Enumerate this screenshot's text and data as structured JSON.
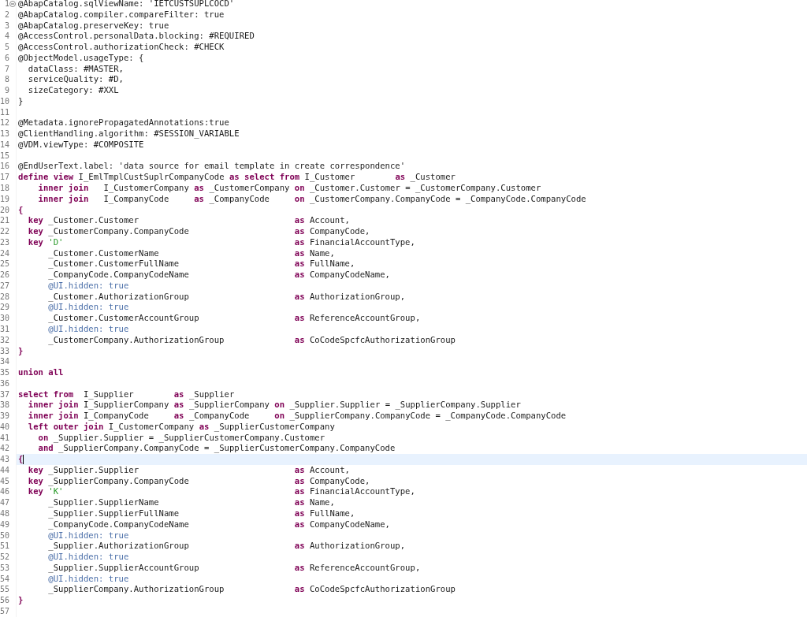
{
  "editor": {
    "lines": [
      {
        "number": "1",
        "current": false,
        "fold": true,
        "tokens": [
          {
            "kind": "plain",
            "text": "@AbapCatalog.sqlViewName: 'IETCUSTSUPLCOCD'"
          }
        ]
      },
      {
        "number": "2",
        "current": false,
        "fold": false,
        "tokens": [
          {
            "kind": "plain",
            "text": "@AbapCatalog.compiler.compareFilter: true"
          }
        ]
      },
      {
        "number": "3",
        "current": false,
        "fold": false,
        "tokens": [
          {
            "kind": "plain",
            "text": "@AbapCatalog.preserveKey: true"
          }
        ]
      },
      {
        "number": "4",
        "current": false,
        "fold": false,
        "tokens": [
          {
            "kind": "plain",
            "text": "@AccessControl.personalData.blocking: #REQUIRED"
          }
        ]
      },
      {
        "number": "5",
        "current": false,
        "fold": false,
        "tokens": [
          {
            "kind": "plain",
            "text": "@AccessControl.authorizationCheck: #CHECK"
          }
        ]
      },
      {
        "number": "6",
        "current": false,
        "fold": false,
        "tokens": [
          {
            "kind": "plain",
            "text": "@ObjectModel.usageType: {"
          }
        ]
      },
      {
        "number": "7",
        "current": false,
        "fold": false,
        "tokens": [
          {
            "kind": "plain",
            "text": "  dataClass: #MASTER,"
          }
        ]
      },
      {
        "number": "8",
        "current": false,
        "fold": false,
        "tokens": [
          {
            "kind": "plain",
            "text": "  serviceQuality: #D,"
          }
        ]
      },
      {
        "number": "9",
        "current": false,
        "fold": false,
        "tokens": [
          {
            "kind": "plain",
            "text": "  sizeCategory: #XXL"
          }
        ]
      },
      {
        "number": "10",
        "current": false,
        "fold": false,
        "tokens": [
          {
            "kind": "plain",
            "text": "}"
          }
        ]
      },
      {
        "number": "11",
        "current": false,
        "fold": false
      },
      {
        "number": "12",
        "current": false,
        "fold": false,
        "tokens": [
          {
            "kind": "plain",
            "text": "@Metadata.ignorePropagatedAnnotations:true"
          }
        ]
      },
      {
        "number": "13",
        "current": false,
        "fold": false,
        "tokens": [
          {
            "kind": "plain",
            "text": "@ClientHandling.algorithm: #SESSION_VARIABLE"
          }
        ]
      },
      {
        "number": "14",
        "current": false,
        "fold": false,
        "tokens": [
          {
            "kind": "plain",
            "text": "@VDM.viewType: #COMPOSITE"
          }
        ]
      },
      {
        "number": "15",
        "current": false,
        "fold": false
      },
      {
        "number": "16",
        "current": false,
        "fold": false,
        "tokens": [
          {
            "kind": "plain",
            "text": "@EndUserText.label: 'data source for email template in create correspondence'"
          }
        ]
      },
      {
        "number": "17",
        "current": false,
        "fold": false,
        "tokens": [
          {
            "kind": "keyword",
            "text": "define view"
          },
          {
            "kind": "plain",
            "text": " I_EmlTmplCustSuplrCompanyCode "
          },
          {
            "kind": "keyword",
            "text": "as select from"
          },
          {
            "kind": "plain",
            "text": " I_Customer        "
          },
          {
            "kind": "keyword",
            "text": "as"
          },
          {
            "kind": "plain",
            "text": " _Customer"
          }
        ]
      },
      {
        "number": "18",
        "current": false,
        "fold": false,
        "tokens": [
          {
            "kind": "keyword",
            "text": "    inner join"
          },
          {
            "kind": "plain",
            "text": "   I_CustomerCompany "
          },
          {
            "kind": "keyword",
            "text": "as"
          },
          {
            "kind": "plain",
            "text": " _CustomerCompany "
          },
          {
            "kind": "keyword",
            "text": "on"
          },
          {
            "kind": "plain",
            "text": " _Customer.Customer = _CustomerCompany.Customer"
          }
        ]
      },
      {
        "number": "19",
        "current": false,
        "fold": false,
        "tokens": [
          {
            "kind": "keyword",
            "text": "    inner join"
          },
          {
            "kind": "plain",
            "text": "   I_CompanyCode     "
          },
          {
            "kind": "keyword",
            "text": "as"
          },
          {
            "kind": "plain",
            "text": " _CompanyCode     "
          },
          {
            "kind": "keyword",
            "text": "on"
          },
          {
            "kind": "plain",
            "text": " _CustomerCompany.CompanyCode = _CompanyCode.CompanyCode"
          }
        ]
      },
      {
        "number": "20",
        "current": false,
        "fold": false,
        "tokens": [
          {
            "kind": "keyword",
            "text": "{"
          }
        ]
      },
      {
        "number": "21",
        "current": false,
        "fold": false,
        "tokens": [
          {
            "kind": "keyword",
            "text": "  key"
          },
          {
            "kind": "plain",
            "text": " _Customer.Customer                               "
          },
          {
            "kind": "keyword",
            "text": "as"
          },
          {
            "kind": "plain",
            "text": " Account,"
          }
        ]
      },
      {
        "number": "22",
        "current": false,
        "fold": false,
        "tokens": [
          {
            "kind": "keyword",
            "text": "  key"
          },
          {
            "kind": "plain",
            "text": " _CustomerCompany.CompanyCode                     "
          },
          {
            "kind": "keyword",
            "text": "as"
          },
          {
            "kind": "plain",
            "text": " CompanyCode,"
          }
        ]
      },
      {
        "number": "23",
        "current": false,
        "fold": false,
        "tokens": [
          {
            "kind": "keyword",
            "text": "  key"
          },
          {
            "kind": "literal",
            "text": " 'D'"
          },
          {
            "kind": "keyword",
            "text": "                                              as"
          },
          {
            "kind": "plain",
            "text": " FinancialAccountType,"
          }
        ]
      },
      {
        "number": "24",
        "current": false,
        "fold": false,
        "tokens": [
          {
            "kind": "plain",
            "text": "      _Customer.CustomerName                           "
          },
          {
            "kind": "keyword",
            "text": "as"
          },
          {
            "kind": "plain",
            "text": " Name,"
          }
        ]
      },
      {
        "number": "25",
        "current": false,
        "fold": false,
        "tokens": [
          {
            "kind": "plain",
            "text": "      _Customer.CustomerFullName                       "
          },
          {
            "kind": "keyword",
            "text": "as"
          },
          {
            "kind": "plain",
            "text": " FullName,"
          }
        ]
      },
      {
        "number": "26",
        "current": false,
        "fold": false,
        "tokens": [
          {
            "kind": "plain",
            "text": "      _CompanyCode.CompanyCodeName                     "
          },
          {
            "kind": "keyword",
            "text": "as"
          },
          {
            "kind": "plain",
            "text": " CompanyCodeName,"
          }
        ]
      },
      {
        "number": "27",
        "current": false,
        "fold": false,
        "tokens": [
          {
            "kind": "annotation",
            "text": "      @UI.hidden: true"
          }
        ]
      },
      {
        "number": "28",
        "current": false,
        "fold": false,
        "tokens": [
          {
            "kind": "plain",
            "text": "      _Customer.AuthorizationGroup                     "
          },
          {
            "kind": "keyword",
            "text": "as"
          },
          {
            "kind": "plain",
            "text": " AuthorizationGroup,"
          }
        ]
      },
      {
        "number": "29",
        "current": false,
        "fold": false,
        "tokens": [
          {
            "kind": "annotation",
            "text": "      @UI.hidden: true"
          }
        ]
      },
      {
        "number": "30",
        "current": false,
        "fold": false,
        "tokens": [
          {
            "kind": "plain",
            "text": "      _Customer.CustomerAccountGroup                   "
          },
          {
            "kind": "keyword",
            "text": "as"
          },
          {
            "kind": "plain",
            "text": " ReferenceAccountGroup,"
          }
        ]
      },
      {
        "number": "31",
        "current": false,
        "fold": false,
        "tokens": [
          {
            "kind": "annotation",
            "text": "      @UI.hidden: true"
          }
        ]
      },
      {
        "number": "32",
        "current": false,
        "fold": false,
        "tokens": [
          {
            "kind": "plain",
            "text": "      _CustomerCompany.AuthorizationGroup              "
          },
          {
            "kind": "keyword",
            "text": "as"
          },
          {
            "kind": "plain",
            "text": " CoCodeSpcfcAuthorizationGroup"
          }
        ]
      },
      {
        "number": "33",
        "current": false,
        "fold": false,
        "tokens": [
          {
            "kind": "keyword",
            "text": "}"
          }
        ]
      },
      {
        "number": "34",
        "current": false,
        "fold": false
      },
      {
        "number": "35",
        "current": false,
        "fold": false,
        "tokens": [
          {
            "kind": "keyword",
            "text": "union all"
          }
        ]
      },
      {
        "number": "36",
        "current": false,
        "fold": false
      },
      {
        "number": "37",
        "current": false,
        "fold": false,
        "tokens": [
          {
            "kind": "keyword",
            "text": "select from"
          },
          {
            "kind": "plain",
            "text": "  I_Supplier        "
          },
          {
            "kind": "keyword",
            "text": "as"
          },
          {
            "kind": "plain",
            "text": " _Supplier"
          }
        ]
      },
      {
        "number": "38",
        "current": false,
        "fold": false,
        "tokens": [
          {
            "kind": "keyword",
            "text": "  inner join"
          },
          {
            "kind": "plain",
            "text": " I_SupplierCompany "
          },
          {
            "kind": "keyword",
            "text": "as"
          },
          {
            "kind": "plain",
            "text": " _SupplierCompany "
          },
          {
            "kind": "keyword",
            "text": "on"
          },
          {
            "kind": "plain",
            "text": " _Supplier.Supplier = _SupplierCompany.Supplier"
          }
        ]
      },
      {
        "number": "39",
        "current": false,
        "fold": false,
        "tokens": [
          {
            "kind": "keyword",
            "text": "  inner join"
          },
          {
            "kind": "plain",
            "text": " I_CompanyCode     "
          },
          {
            "kind": "keyword",
            "text": "as"
          },
          {
            "kind": "plain",
            "text": " _CompanyCode     "
          },
          {
            "kind": "keyword",
            "text": "on"
          },
          {
            "kind": "plain",
            "text": " _SupplierCompany.CompanyCode = _CompanyCode.CompanyCode"
          }
        ]
      },
      {
        "number": "40",
        "current": false,
        "fold": false,
        "tokens": [
          {
            "kind": "keyword",
            "text": "  left outer join"
          },
          {
            "kind": "plain",
            "text": " I_CustomerCompany "
          },
          {
            "kind": "keyword",
            "text": "as"
          },
          {
            "kind": "plain",
            "text": " _SupplierCustomerCompany"
          }
        ]
      },
      {
        "number": "41",
        "current": false,
        "fold": false,
        "tokens": [
          {
            "kind": "keyword",
            "text": "    on"
          },
          {
            "kind": "plain",
            "text": " _Supplier.Supplier = _SupplierCustomerCompany.Customer"
          }
        ]
      },
      {
        "number": "42",
        "current": false,
        "fold": false,
        "tokens": [
          {
            "kind": "keyword",
            "text": "    and"
          },
          {
            "kind": "plain",
            "text": " _SupplierCompany.CompanyCode = _SupplierCustomerCompany.CompanyCode"
          }
        ]
      },
      {
        "number": "43",
        "current": true,
        "fold": false,
        "tokens": [
          {
            "kind": "keyword",
            "text": "{"
          }
        ]
      },
      {
        "number": "44",
        "current": false,
        "fold": false,
        "tokens": [
          {
            "kind": "keyword",
            "text": "  key"
          },
          {
            "kind": "plain",
            "text": " _Supplier.Supplier                               "
          },
          {
            "kind": "keyword",
            "text": "as"
          },
          {
            "kind": "plain",
            "text": " Account,"
          }
        ]
      },
      {
        "number": "45",
        "current": false,
        "fold": false,
        "tokens": [
          {
            "kind": "keyword",
            "text": "  key"
          },
          {
            "kind": "plain",
            "text": " _SupplierCompany.CompanyCode                     "
          },
          {
            "kind": "keyword",
            "text": "as"
          },
          {
            "kind": "plain",
            "text": " CompanyCode,"
          }
        ]
      },
      {
        "number": "46",
        "current": false,
        "fold": false,
        "tokens": [
          {
            "kind": "keyword",
            "text": "  key"
          },
          {
            "kind": "literal",
            "text": " 'K'"
          },
          {
            "kind": "keyword",
            "text": "                                              as"
          },
          {
            "kind": "plain",
            "text": " FinancialAccountType,"
          }
        ]
      },
      {
        "number": "47",
        "current": false,
        "fold": false,
        "tokens": [
          {
            "kind": "plain",
            "text": "      _Supplier.SupplierName                           "
          },
          {
            "kind": "keyword",
            "text": "as"
          },
          {
            "kind": "plain",
            "text": " Name,"
          }
        ]
      },
      {
        "number": "48",
        "current": false,
        "fold": false,
        "tokens": [
          {
            "kind": "plain",
            "text": "      _Supplier.SupplierFullName                       "
          },
          {
            "kind": "keyword",
            "text": "as"
          },
          {
            "kind": "plain",
            "text": " FullName,"
          }
        ]
      },
      {
        "number": "49",
        "current": false,
        "fold": false,
        "tokens": [
          {
            "kind": "plain",
            "text": "      _CompanyCode.CompanyCodeName                     "
          },
          {
            "kind": "keyword",
            "text": "as"
          },
          {
            "kind": "plain",
            "text": " CompanyCodeName,"
          }
        ]
      },
      {
        "number": "50",
        "current": false,
        "fold": false,
        "tokens": [
          {
            "kind": "annotation",
            "text": "      @UI.hidden: true"
          }
        ]
      },
      {
        "number": "51",
        "current": false,
        "fold": false,
        "tokens": [
          {
            "kind": "plain",
            "text": "      _Supplier.AuthorizationGroup                     "
          },
          {
            "kind": "keyword",
            "text": "as"
          },
          {
            "kind": "plain",
            "text": " AuthorizationGroup,"
          }
        ]
      },
      {
        "number": "52",
        "current": false,
        "fold": false,
        "tokens": [
          {
            "kind": "annotation",
            "text": "      @UI.hidden: true"
          }
        ]
      },
      {
        "number": "53",
        "current": false,
        "fold": false,
        "tokens": [
          {
            "kind": "plain",
            "text": "      _Supplier.SupplierAccountGroup                   "
          },
          {
            "kind": "keyword",
            "text": "as"
          },
          {
            "kind": "plain",
            "text": " ReferenceAccountGroup,"
          }
        ]
      },
      {
        "number": "54",
        "current": false,
        "fold": false,
        "tokens": [
          {
            "kind": "annotation",
            "text": "      @UI.hidden: true"
          }
        ]
      },
      {
        "number": "55",
        "current": false,
        "fold": false,
        "tokens": [
          {
            "kind": "plain",
            "text": "      _SupplierCompany.AuthorizationGroup              "
          },
          {
            "kind": "keyword",
            "text": "as"
          },
          {
            "kind": "plain",
            "text": " CoCodeSpcfcAuthorizationGroup"
          }
        ]
      },
      {
        "number": "56",
        "current": false,
        "fold": false,
        "tokens": [
          {
            "kind": "keyword",
            "text": "}"
          }
        ]
      },
      {
        "number": "57",
        "current": false,
        "fold": false
      }
    ]
  }
}
